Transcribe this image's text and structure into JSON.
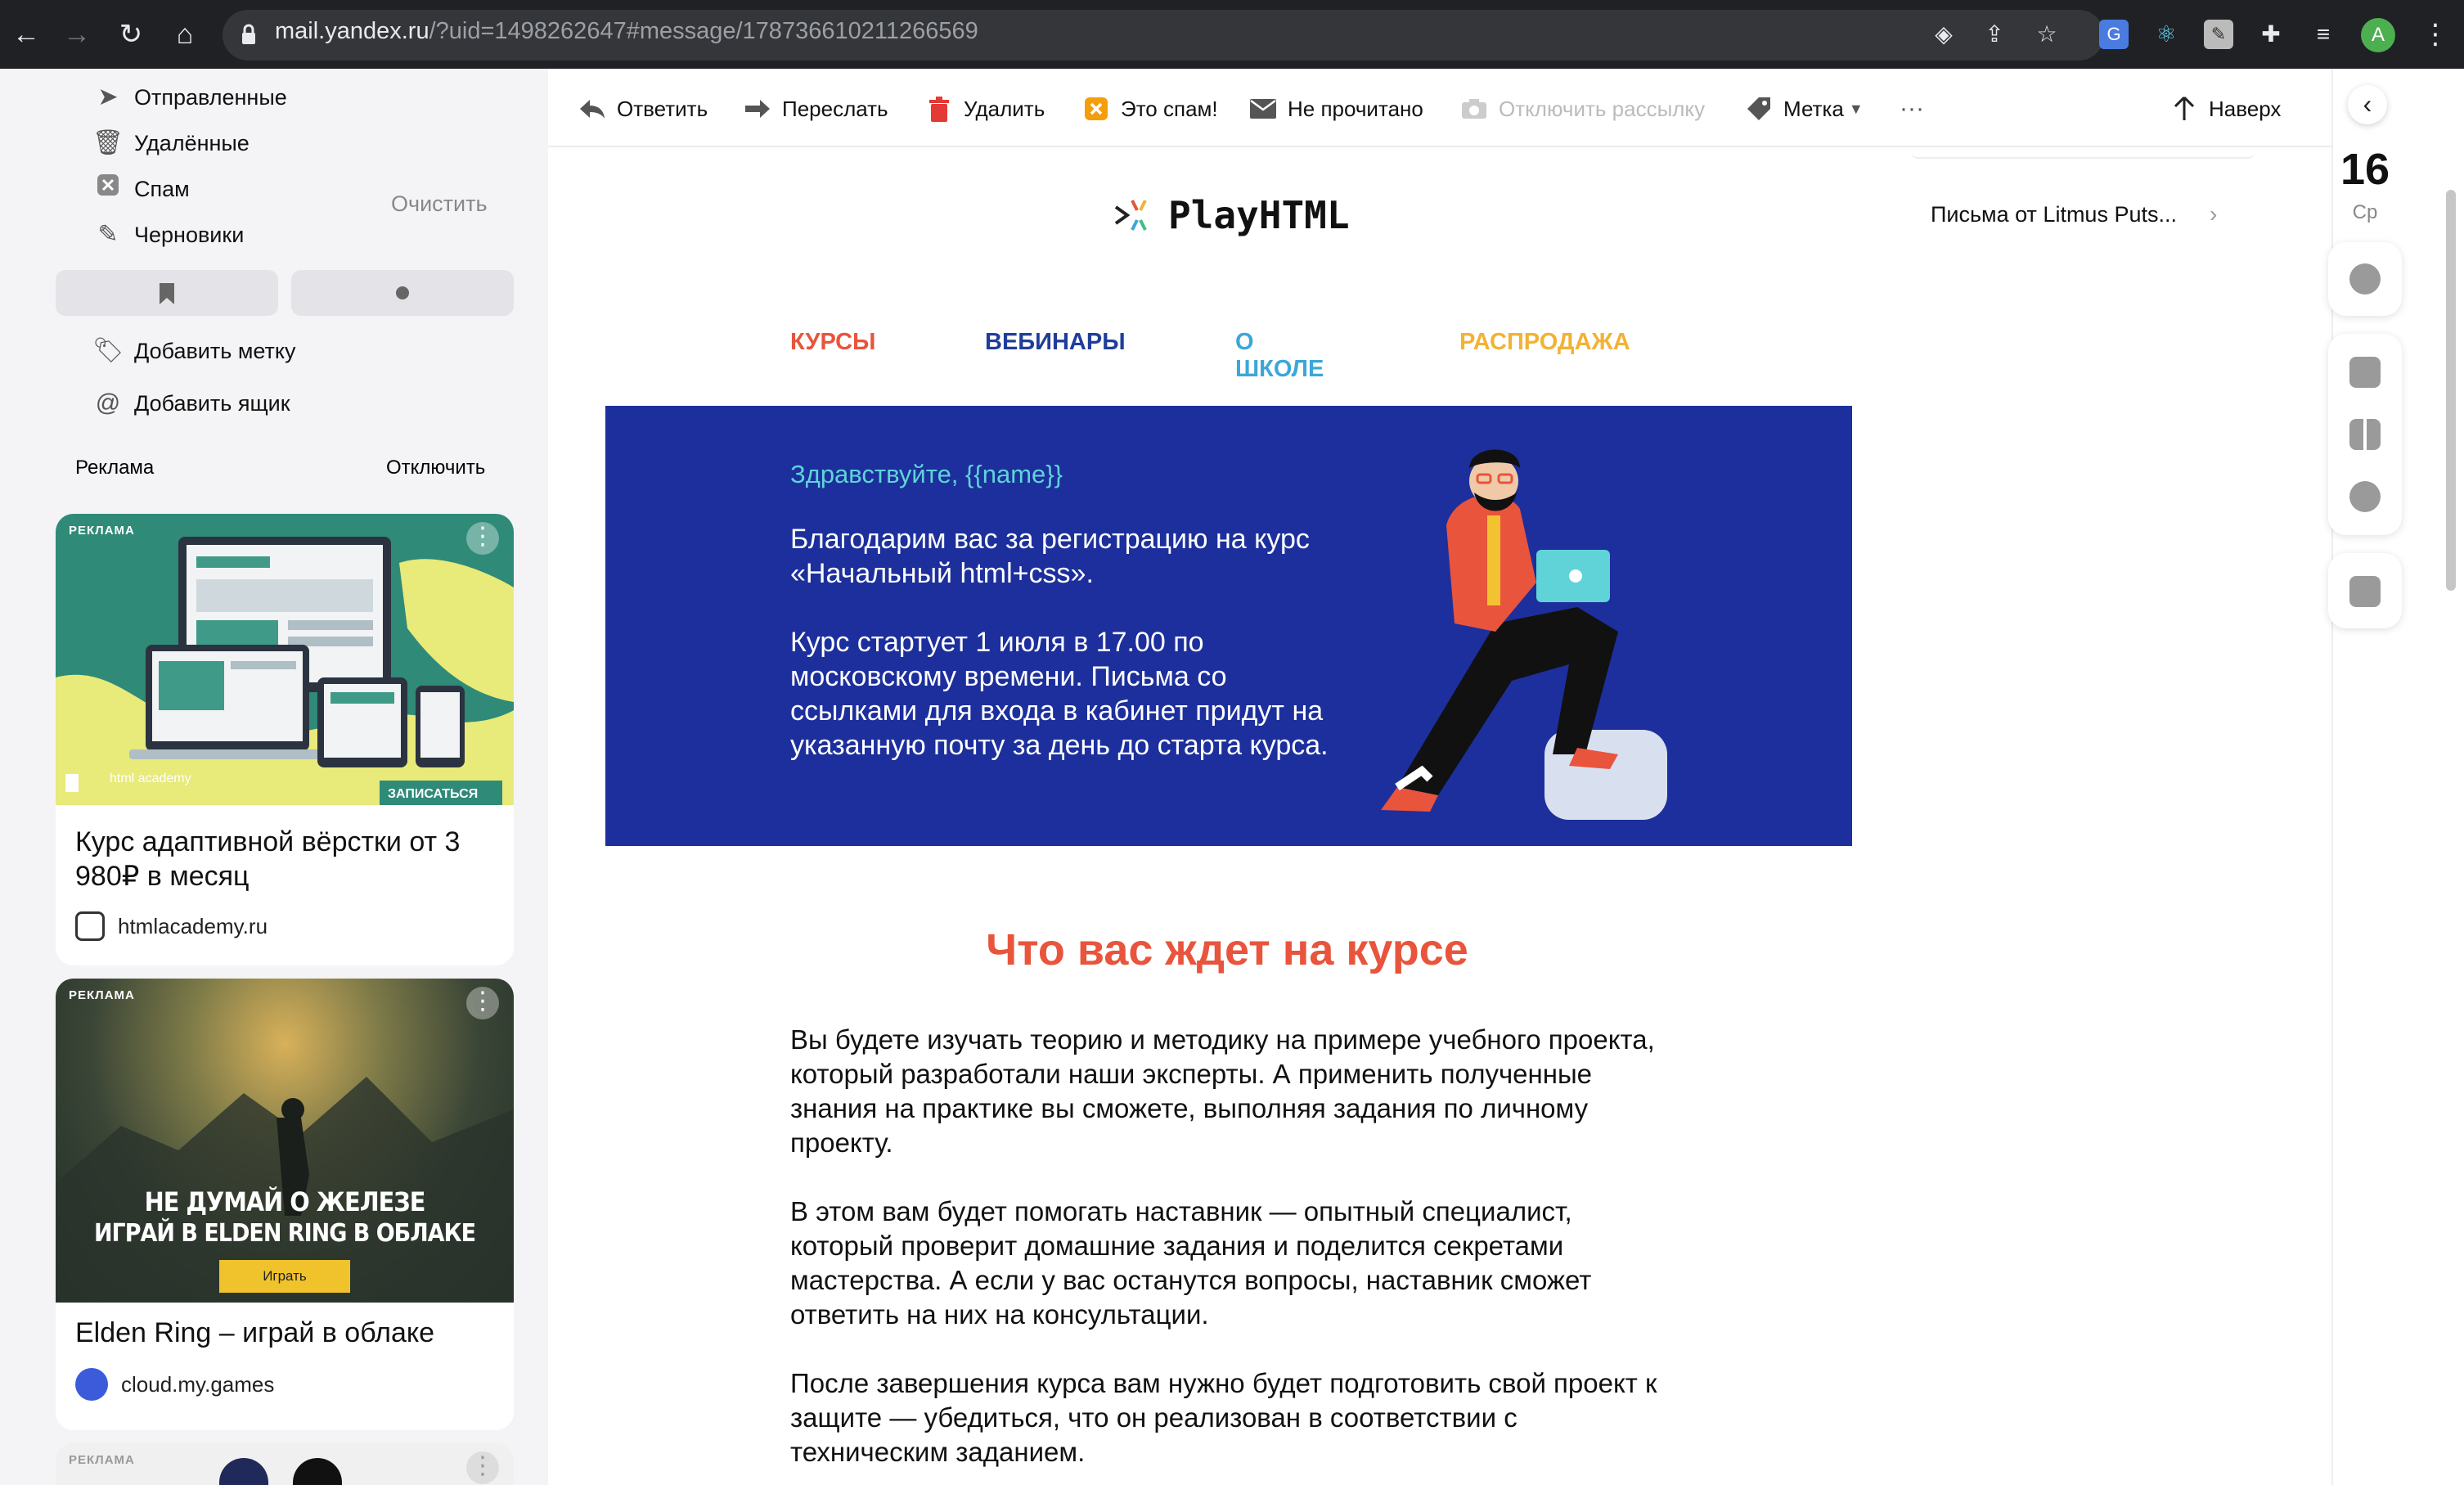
{
  "browser": {
    "url_host": "mail.yandex.ru",
    "url_path": "/?uid=1498262647#message/178736610211266569",
    "avatar_letter": "A"
  },
  "sidebar": {
    "folders": [
      {
        "label": "Отправленные",
        "icon": "send-icon"
      },
      {
        "label": "Удалённые",
        "icon": "trash-icon"
      },
      {
        "label": "Спам",
        "icon": "spam-icon"
      },
      {
        "label": "Черновики",
        "icon": "pencil-icon"
      }
    ],
    "clear_label": "Очистить",
    "add_label": "Добавить метку",
    "add_mailbox": "Добавить ящик",
    "ads_title": "Реклама",
    "ads_off": "Отключить"
  },
  "ads": [
    {
      "tag": "РЕКЛАМА",
      "title": "Курс адаптивной вёрстки от 3 980₽ в месяц",
      "domain": "htmlacademy.ru",
      "banner_logo": "html academy",
      "banner_cta": "ЗАПИСАТЬСЯ"
    },
    {
      "tag": "РЕКЛАМА",
      "title": "Elden Ring – играй в облаке",
      "domain": "cloud.my.games",
      "banner_line1": "НЕ ДУМАЙ О ЖЕЛЕЗЕ",
      "banner_line2": "ИГРАЙ В ELDEN RING В ОБЛАКЕ",
      "banner_cta": "Играть"
    },
    {
      "tag": "РЕКЛАМА"
    }
  ],
  "toolbar": {
    "reply": "Ответить",
    "forward": "Переслать",
    "delete": "Удалить",
    "spam": "Это спам!",
    "unread": "Не прочитано",
    "unsubscribe": "Отключить рассылку",
    "label": "Метка",
    "more": "···",
    "up": "Наверх"
  },
  "email": {
    "logo_text": "PlayHTML",
    "nav": [
      {
        "label": "КУРСЫ",
        "color": "#e8543c"
      },
      {
        "label": "ВЕБИНАРЫ",
        "color": "#1f3e9a"
      },
      {
        "label": "О ШКОЛЕ",
        "color": "#3ca6d9"
      },
      {
        "label": "РАСПРОДАЖА",
        "color": "#f2b233"
      }
    ],
    "banner": {
      "greeting": "Здравствуйте, {{name}}",
      "p1": "Благодарим вас за регистрацию на курс «Начальный html+css».",
      "p2": "Курс стартует 1 июля в 17.00 по московскому времени. Письма со ссылками для входа в кабинет придут на указанную почту за день до старта курса.",
      "bg_color": "#1c2f9c",
      "greeting_color": "#5fd3d8"
    },
    "section_title": "Что вас ждет на курсе",
    "section_title_color": "#e8543c",
    "paragraphs": [
      "Вы будете изучать теорию и методику на примере учебного проекта, который разработали наши эксперты. А применить полученные знания на практике вы сможете, выполняя задания по личному проекту.",
      "В этом вам будет помогать наставник — опытный специалист, который проверит домашние задания и поделится секретами мастерства. А если у вас останутся вопросы, наставник сможет ответить на них на консультации.",
      "После завершения курса вам нужно будет подготовить свой проект к защите — убедиться, что он реализован в соответствии с техническим заданием."
    ]
  },
  "thread_link": "Письма от Litmus Puts...",
  "date": {
    "day": "16",
    "weekday": "Ср"
  }
}
